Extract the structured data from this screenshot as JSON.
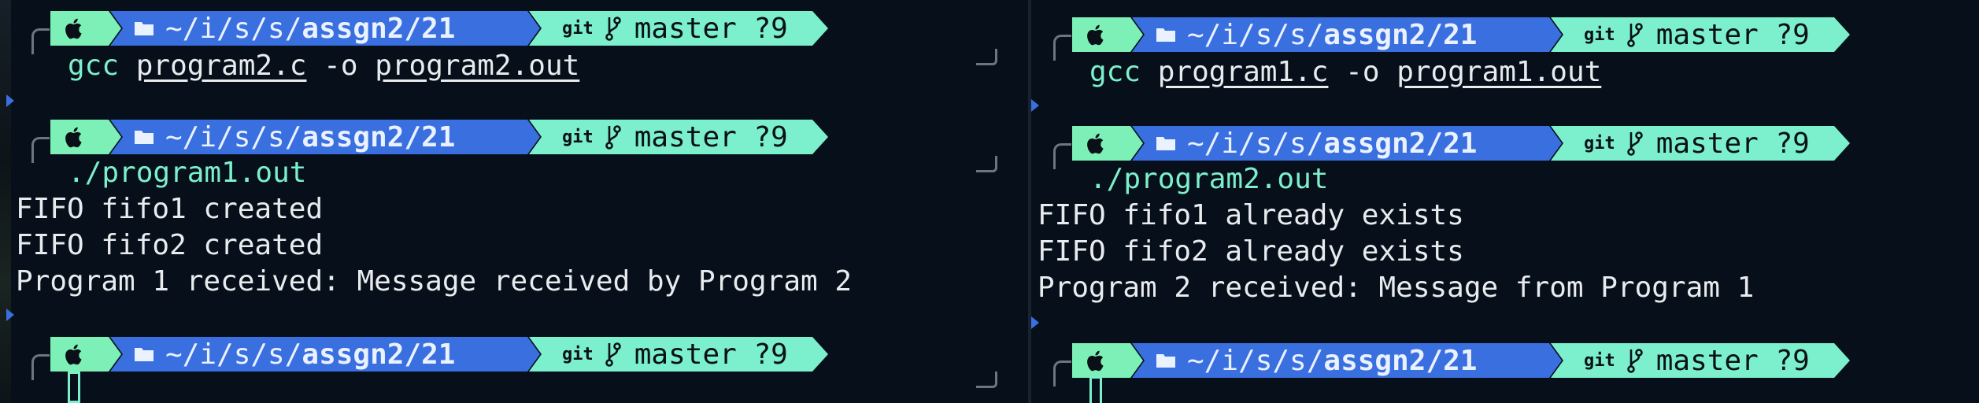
{
  "panes": [
    {
      "id": "left",
      "blocks": [
        {
          "prompt": {
            "path_dim": "~/i/s/s/",
            "path_strong": "assgn2/21",
            "git_label": "git",
            "branch": "master ?9"
          },
          "command": {
            "bin": "gcc",
            "arg1": "program2.c",
            "flag": "-o",
            "arg2": "program2.out"
          }
        },
        {
          "prompt": {
            "path_dim": "~/i/s/s/",
            "path_strong": "assgn2/21",
            "git_label": "git",
            "branch": "master ?9"
          },
          "exec": "./program1.out",
          "output": [
            "FIFO fifo1 created",
            "FIFO fifo2 created",
            "Program 1 received: Message received by Program 2"
          ]
        },
        {
          "prompt": {
            "path_dim": "~/i/s/s/",
            "path_strong": "assgn2/21",
            "git_label": "git",
            "branch": "master ?9"
          }
        }
      ]
    },
    {
      "id": "right",
      "blocks": [
        {
          "prompt": {
            "path_dim": "~/i/s/s/",
            "path_strong": "assgn2/21",
            "git_label": "git",
            "branch": "master ?9"
          },
          "command": {
            "bin": "gcc",
            "arg1": "program1.c",
            "flag": "-o",
            "arg2": "program1.out"
          }
        },
        {
          "prompt": {
            "path_dim": "~/i/s/s/",
            "path_strong": "assgn2/21",
            "git_label": "git",
            "branch": "master ?9"
          },
          "exec": "./program2.out",
          "output": [
            "FIFO fifo1 already exists",
            "FIFO fifo2 already exists",
            "Program 2 received: Message from Program 1"
          ]
        },
        {
          "prompt": {
            "path_dim": "~/i/s/s/",
            "path_strong": "assgn2/21",
            "git_label": "git",
            "branch": "master ?9"
          }
        }
      ]
    }
  ],
  "colors": {
    "apple_segment": "#7cf0b6",
    "path_segment": "#3a6fe0",
    "git_segment": "#7cf0cc",
    "background": "#07101a"
  },
  "icons": {
    "os": "apple-icon",
    "folder": "folder-icon",
    "branch": "git-branch-icon"
  }
}
